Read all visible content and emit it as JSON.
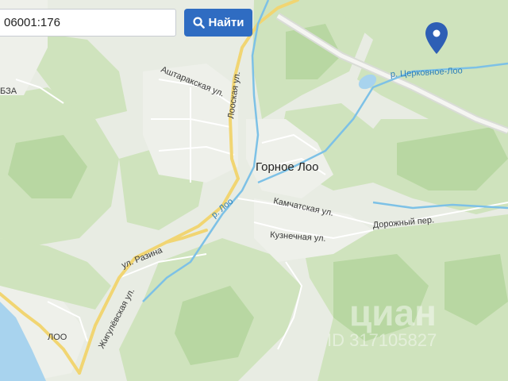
{
  "search": {
    "value": "06001:176",
    "button_label": "Найти"
  },
  "map": {
    "village_name": "Горное Лоо",
    "streets": {
      "ashtarakskaya": "Аштаракская ул.",
      "looskaya": "Лооская ул.",
      "kamchatskaya": "Камчатская ул.",
      "kuznechnaya": "Кузнечная ул.",
      "dorozhny": "Дорожный пер.",
      "razina": "ул. Разина",
      "zhigulevskaya": "Жигулёвская ул."
    },
    "rivers": {
      "loo": "р. Лоо",
      "tserkovnoe_loo": "р. Церковное-Лоо"
    },
    "area_labels": {
      "loo": "ЛОО",
      "bza": "БЗА"
    },
    "watermark": {
      "brand": "циан",
      "id": "ID 317105827"
    }
  },
  "colors": {
    "forest": "#cfe3bd",
    "forest_dark": "#b8d7a2",
    "sea": "#a8d3ee",
    "road": "#f1d572",
    "river": "#7dc1e6",
    "accent": "#2f6cc2",
    "marker": "#2e5fb5"
  },
  "icons": {
    "search_button": "search-icon",
    "marker": "map-pin-icon"
  }
}
